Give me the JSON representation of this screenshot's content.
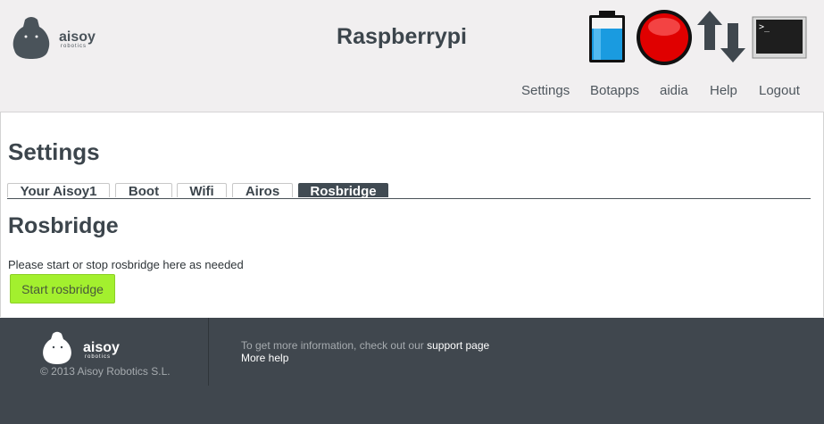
{
  "header": {
    "logo_text": "aisoy",
    "logo_subtext": "robotics",
    "device_name": "Raspberrypi",
    "icons": [
      "battery-icon",
      "record-icon",
      "transfer-icon",
      "terminal-icon"
    ],
    "nav": {
      "settings": "Settings",
      "botapps": "Botapps",
      "aidia": "aidia",
      "help": "Help",
      "logout": "Logout"
    }
  },
  "main": {
    "page_title": "Settings",
    "tabs": [
      {
        "label": "Your Aisoy1",
        "active": false
      },
      {
        "label": "Boot",
        "active": false
      },
      {
        "label": "Wifi",
        "active": false
      },
      {
        "label": "Airos",
        "active": false
      },
      {
        "label": "Rosbridge",
        "active": true
      }
    ],
    "section_title": "Rosbridge",
    "section_description": "Please start or stop rosbridge here as needed",
    "start_button_label": "Start rosbridge"
  },
  "footer": {
    "logo_text": "aisoy",
    "logo_subtext": "robotics",
    "copyright": "© 2013 Aisoy Robotics S.L.",
    "info_text": "To get more information, check out our",
    "support_link": "support page",
    "more_help": "More help"
  },
  "colors": {
    "header_bg": "#f1eff0",
    "footer_bg": "#40474e",
    "active_tab": "#404a52",
    "button_green": "#a3f02e",
    "record_red": "#e00000",
    "battery_blue": "#1a9be0"
  }
}
